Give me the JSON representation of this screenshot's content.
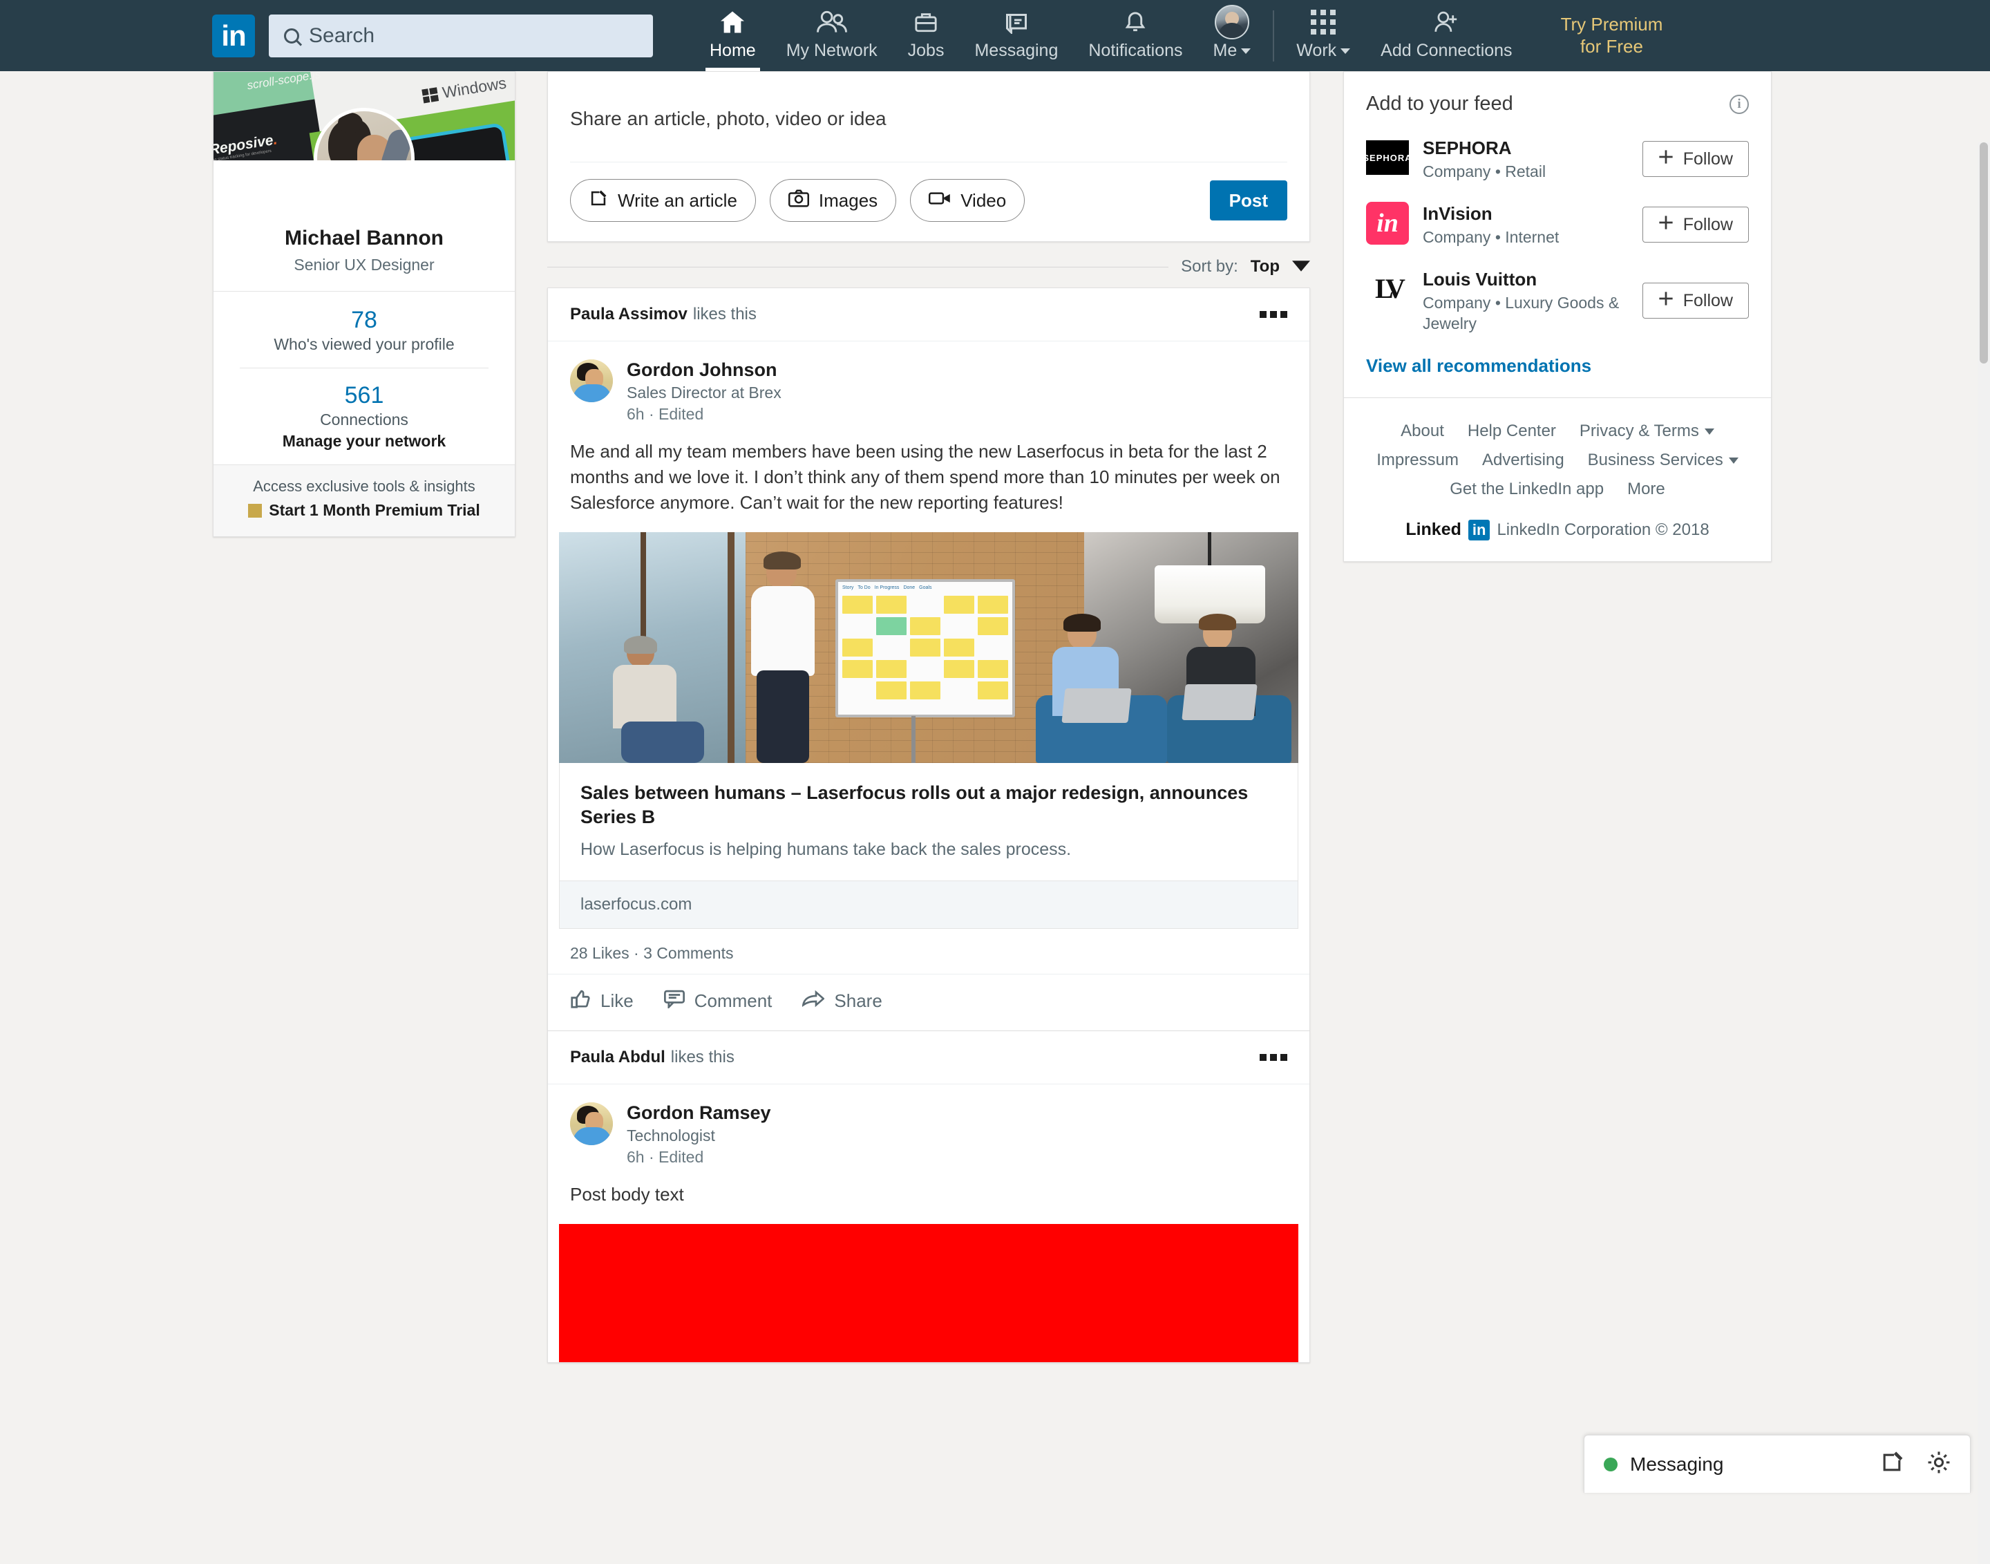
{
  "nav": {
    "logo": "in",
    "search_placeholder": "Search",
    "items": [
      {
        "label": "Home",
        "icon": "home-icon",
        "active": true
      },
      {
        "label": "My Network",
        "icon": "people-icon",
        "active": false
      },
      {
        "label": "Jobs",
        "icon": "briefcase-icon",
        "active": false
      },
      {
        "label": "Messaging",
        "icon": "message-icon",
        "active": false
      },
      {
        "label": "Notifications",
        "icon": "bell-icon",
        "active": false
      },
      {
        "label": "Me",
        "icon": "avatar-icon",
        "active": false
      }
    ],
    "work_label": "Work",
    "add_connections_label": "Add Connections",
    "premium_line1": "Try Premium",
    "premium_line2": "for Free"
  },
  "profile": {
    "cover": {
      "text_scroll": "scroll-scope.js",
      "text_repo": "Reposive",
      "text_repo_dot": ".",
      "text_repo_sub": "the status tracking for developers",
      "text_windows": "Windows"
    },
    "name": "Michael Bannon",
    "title": "Senior UX Designer",
    "stats": [
      {
        "number": "78",
        "label": "Who's viewed your profile"
      },
      {
        "number": "561",
        "label": "Connections"
      }
    ],
    "manage_network": "Manage your network",
    "premium_subtitle": "Access exclusive tools & insights",
    "premium_cta": "Start 1 Month Premium Trial"
  },
  "share": {
    "prompt": "Share an article, photo, video or idea",
    "write_article": "Write an article",
    "images": "Images",
    "video": "Video",
    "post": "Post"
  },
  "sort": {
    "label": "Sort by:",
    "value": "Top"
  },
  "posts": [
    {
      "liked_by_name": "Paula Assimov",
      "liked_by_suffix": "likes this",
      "author": "Gordon Johnson",
      "role": "Sales Director at Brex",
      "time": "6h · Edited",
      "text": "Me and all my team members have been using the new Laserfocus in beta for the last 2 months and we love it. I don’t think any of them spend more than 10 minutes per week on Salesforce anymore. Can’t wait for the new reporting features!",
      "article": {
        "title": "Sales between humans – Laserfocus rolls out a major redesign, announces Series B",
        "description": "How Laserfocus is helping humans take back the sales process.",
        "source": "laserfocus.com"
      },
      "counts": "28 Likes · 3 Comments",
      "actions": [
        "Like",
        "Comment",
        "Share"
      ]
    },
    {
      "liked_by_name": "Paula Abdul",
      "liked_by_suffix": "likes this",
      "author": "Gordon Ramsey",
      "role": "Technologist",
      "time": "6h · Edited",
      "text": "Post body text",
      "media_color": "#ff0000"
    }
  ],
  "feed_panel": {
    "title": "Add to your feed",
    "items": [
      {
        "name": "SEPHORA",
        "subtitle": "Company • Retail",
        "follow_label": "Follow",
        "logo": "sephora-logo"
      },
      {
        "name": "InVision",
        "subtitle": "Company • Internet",
        "follow_label": "Follow",
        "logo": "invision-logo"
      },
      {
        "name": "Louis Vuitton",
        "subtitle": "Company • Luxury Goods & Jewelry",
        "follow_label": "Follow",
        "logo": "louis-vuitton-logo"
      }
    ],
    "view_all": "View all recommendations"
  },
  "footer": {
    "links": [
      "About",
      "Help Center",
      "Privacy & Terms",
      "Impressum",
      "Advertising",
      "Business Services",
      "Get the LinkedIn app",
      "More"
    ],
    "brand_linked": "Linked",
    "brand_in": "in",
    "copyright": "LinkedIn Corporation © 2018"
  },
  "messaging": {
    "label": "Messaging"
  },
  "colors": {
    "nav_bg": "#283e4a",
    "brand_blue": "#0077b5",
    "link_blue": "#0073b1",
    "premium_gold": "#e7c878",
    "page_bg": "#f3f2f0",
    "status_green": "#3aa757",
    "media_red": "#ff0000"
  }
}
